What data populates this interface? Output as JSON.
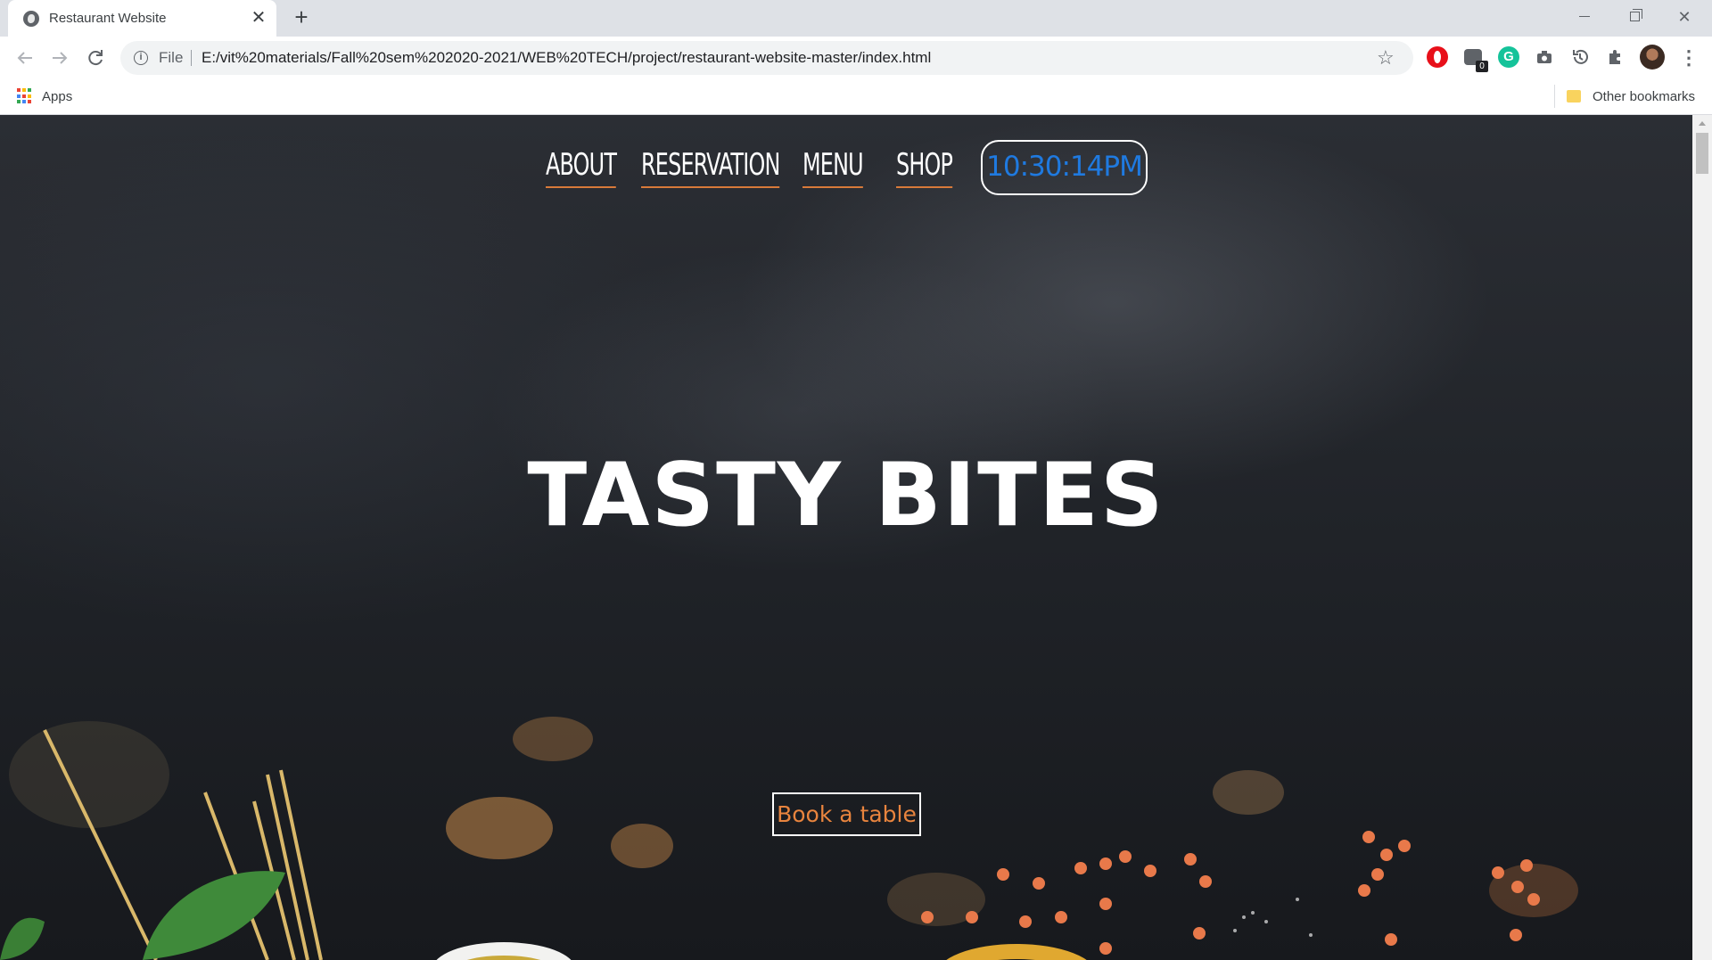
{
  "browser": {
    "tab_title": "Restaurant Website",
    "tab_close": "✕",
    "new_tab": "+",
    "window_min": "",
    "window_max": "",
    "window_close": "✕",
    "scheme": "File",
    "url": "E:/vit%20materials/Fall%20sem%202020-2021/WEB%20TECH/project/restaurant-website-master/index.html",
    "extension_badge_count": "0",
    "bookmarks": {
      "apps_label": "Apps",
      "other_bookmarks_label": "Other bookmarks"
    },
    "icons": [
      "back-icon",
      "forward-icon",
      "reload-icon",
      "info-icon",
      "star-icon",
      "opera-icon",
      "extension-icon",
      "grammarly-icon",
      "camera-icon",
      "history-icon",
      "puzzle-icon",
      "avatar",
      "more-icon",
      "apps-icon",
      "folder-icon"
    ]
  },
  "site": {
    "nav": [
      {
        "label": "ABOUT"
      },
      {
        "label": "RESERVATION"
      },
      {
        "label": "MENU"
      },
      {
        "label": "SHOP"
      }
    ],
    "clock": "10:30:14PM",
    "hero_title": "TASTY BITES",
    "cta_label": "Book a table",
    "colors": {
      "nav_underline": "#d87a3a",
      "clock_text": "#1f7ae0",
      "cta_text": "#e8843e",
      "background": "#1f2227"
    }
  }
}
